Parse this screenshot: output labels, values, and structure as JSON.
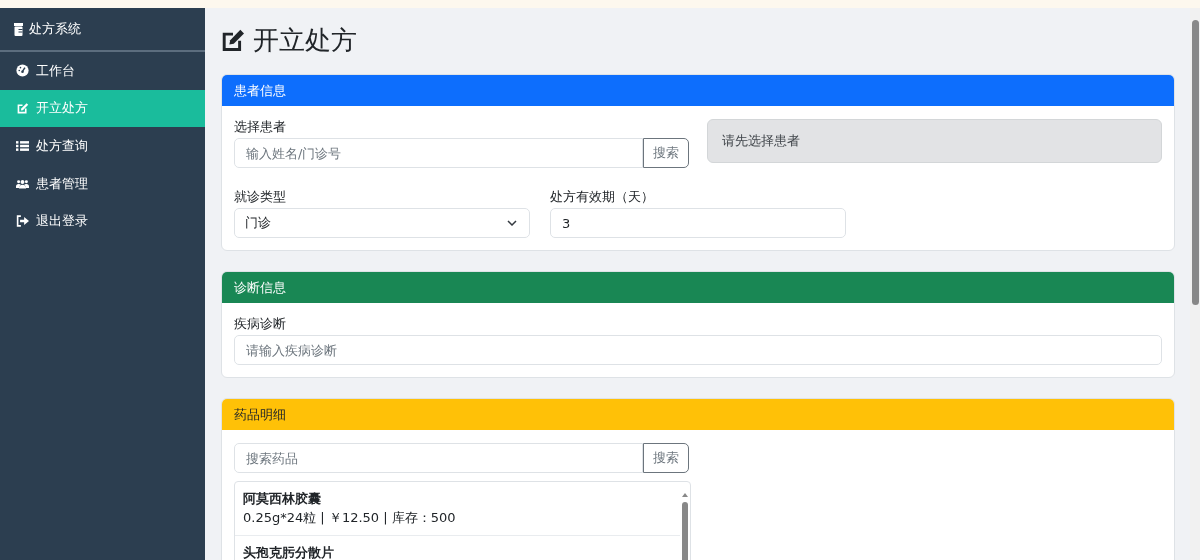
{
  "sidebar": {
    "brand": "处方系统",
    "items": [
      {
        "label": "工作台",
        "selected": false
      },
      {
        "label": "开立处方",
        "selected": true
      },
      {
        "label": "处方查询",
        "selected": false
      },
      {
        "label": "患者管理",
        "selected": false
      },
      {
        "label": "退出登录",
        "selected": false
      }
    ]
  },
  "page_title": "开立处方",
  "sections": [
    {
      "kind": "patient",
      "title": "患者信息",
      "color": "#0d6efd",
      "patient_label": "选择患者",
      "patient_placeholder": "输入姓名/门诊号",
      "search_button": "搜索",
      "patient_notice": "请先选择患者",
      "visit_type_label": "就诊类型",
      "visit_type_value": "门诊",
      "validity_label": "处方有效期（天）",
      "validity_value": "3"
    },
    {
      "kind": "diagnosis",
      "title": "诊断信息",
      "color": "#198754",
      "diagnosis_label": "疾病诊断",
      "diagnosis_placeholder": "请输入疾病诊断"
    },
    {
      "kind": "medicines",
      "title": "药品明细",
      "color": "#ffc107",
      "search_placeholder": "搜索药品",
      "search_button": "搜索",
      "medicines": [
        {
          "name": "阿莫西林胶囊",
          "detail": "0.25g*24粒 | ￥12.50 | 库存：500"
        },
        {
          "name": "头孢克肟分散片"
        }
      ]
    }
  ]
}
